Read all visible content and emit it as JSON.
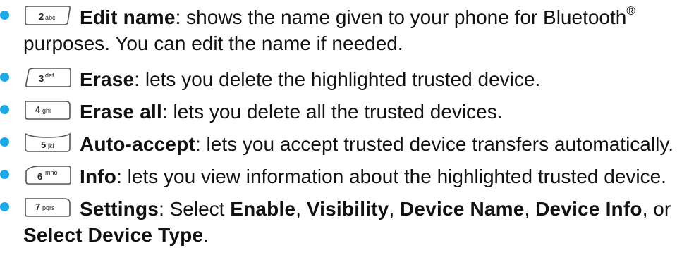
{
  "colors": {
    "bullet": "#1da9e8"
  },
  "items": [
    {
      "key_label": "2abc",
      "icon": "key-2-icon",
      "title": "Edit name",
      "desc": ": shows the name given to your phone for Bluetooth",
      "reg": "®",
      "desc2": "purposes. You can edit the name if needed."
    },
    {
      "key_label": "3def",
      "icon": "key-3-icon",
      "title": "Erase",
      "desc": ": lets you delete the highlighted trusted device."
    },
    {
      "key_label": "4ghi",
      "icon": "key-4-icon",
      "title": "Erase all",
      "desc": ": lets you delete all the trusted devices."
    },
    {
      "key_label": "5jkl",
      "icon": "key-5-icon",
      "title": "Auto-accept",
      "desc": ": lets you accept trusted device transfers automatically."
    },
    {
      "key_label": "6mno",
      "icon": "key-6-icon",
      "title": "Info",
      "desc": ": lets you view information about the highlighted trusted device."
    },
    {
      "key_label": "7pqrs",
      "icon": "key-7-icon",
      "title": "Settings",
      "desc_a": ": Select ",
      "opt1": "Enable",
      "sep1": ", ",
      "opt2": "Visibility",
      "sep2": ", ",
      "opt3": "Device Name",
      "sep3": ", ",
      "opt4": "Device Info",
      "sep4": ", or",
      "opt5": "Select Device Type",
      "end": "."
    }
  ]
}
